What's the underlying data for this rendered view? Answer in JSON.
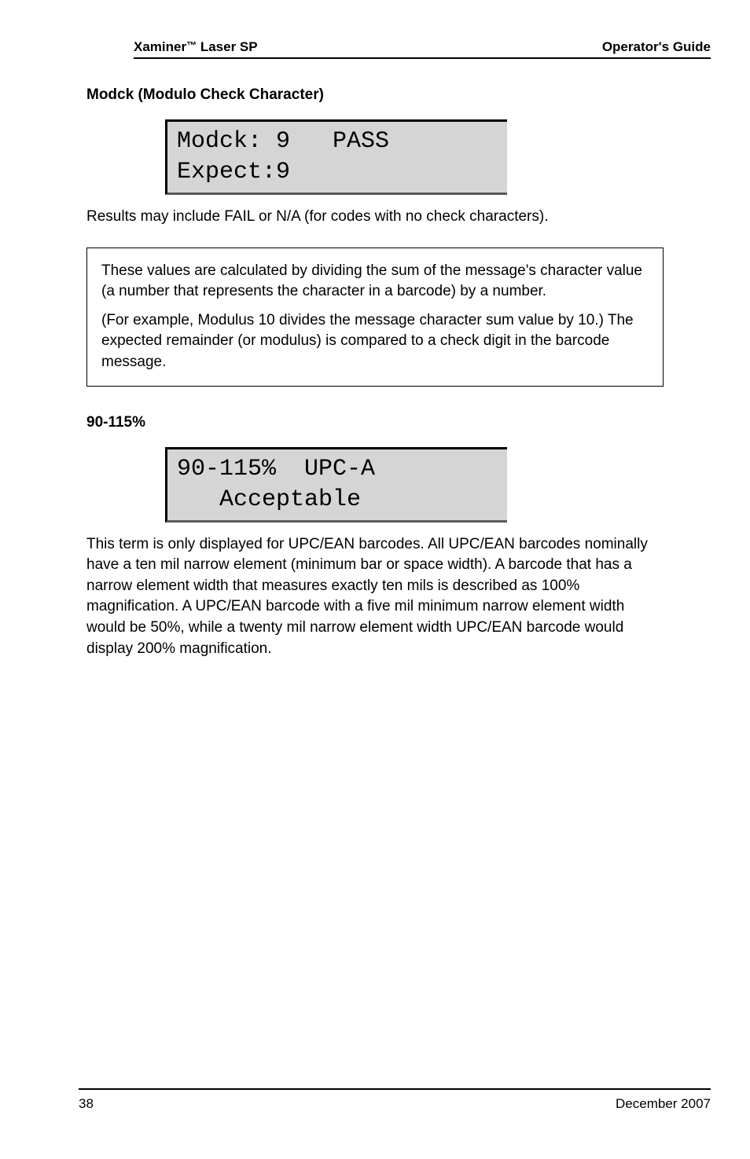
{
  "header": {
    "left_prefix": "Xaminer",
    "left_suffix": " Laser SP",
    "right_prefix": "Operator",
    "right_suffix": "'s Guide"
  },
  "sections": {
    "modck_title": "Modck (Modulo Check Character)",
    "magnification_title": "90-115%"
  },
  "displays": {
    "modck": "Modck: 9   PASS\nExpect:9",
    "magnification": "90-115%  UPC-A\n   Acceptable"
  },
  "paragraphs": {
    "modck_intro_1": "Results may include FAIL or N/A (for codes with no check characters).",
    "modck_intro_2": "These values are calculated by dividing the sum of the message's character value (a number that represents the character in a barcode) by a number.",
    "modck_intro_3": "(For example, Modulus 10 divides the message character sum value by 10.) The expected remainder (or modulus) is compared to a check digit in the barcode message.",
    "magnification_body": "This term is only displayed for UPC/EAN barcodes. All UPC/EAN barcodes nominally have a ten mil narrow element (minimum bar or space width). A barcode that has a narrow element width that measures exactly ten mils is described as 100% magnification. A UPC/EAN barcode with a five mil minimum narrow element width would be 50%, while a twenty mil narrow element width UPC/EAN barcode would display 200% magnification."
  },
  "footer": {
    "left": "38",
    "right": "December 2007"
  }
}
